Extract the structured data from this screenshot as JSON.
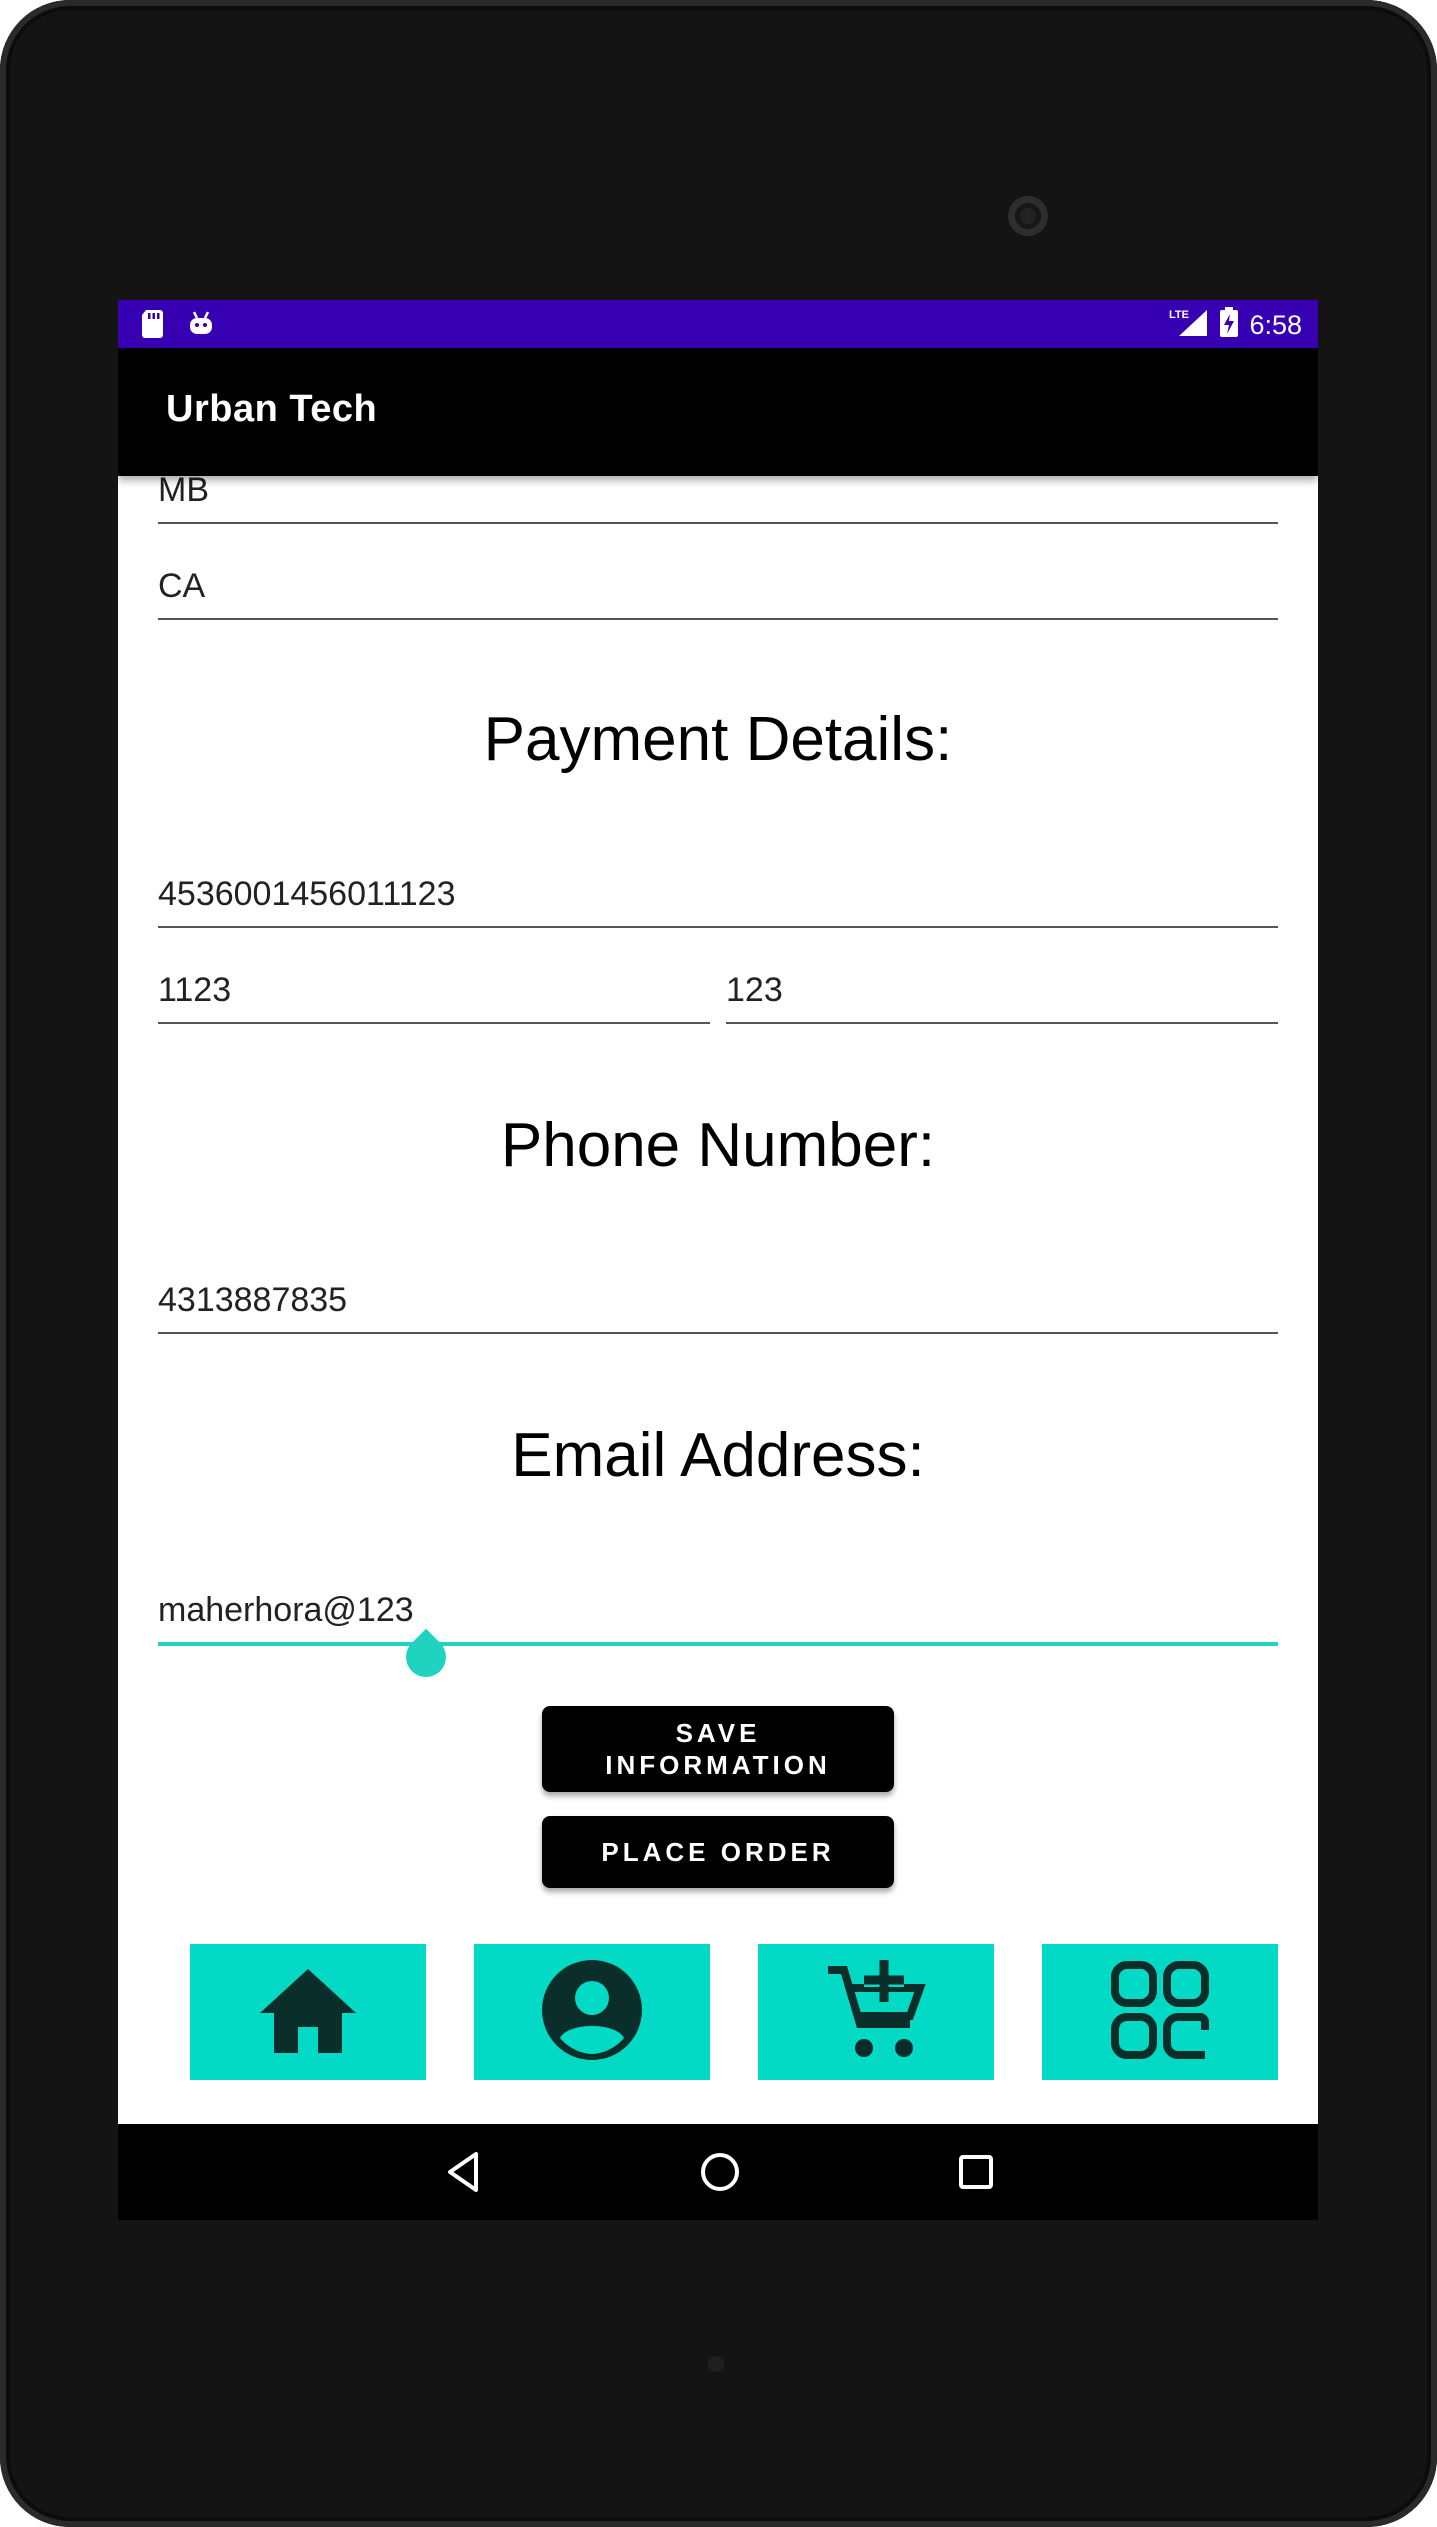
{
  "status_bar": {
    "time": "6:58",
    "network": "LTE"
  },
  "app_bar": {
    "title": "Urban Tech"
  },
  "form": {
    "province": "MB",
    "country": "CA",
    "payment_heading": "Payment Details:",
    "card_number": "4536001456011123",
    "expiry": "1123",
    "cvv": "123",
    "phone_heading": "Phone Number:",
    "phone": "4313887835",
    "email_heading": "Email Address:",
    "email": "maherhora@123"
  },
  "buttons": {
    "save_line1": "SAVE",
    "save_line2": "INFORMATION",
    "place_order": "PLACE ORDER"
  },
  "bottom_nav": {
    "items": [
      "home-icon",
      "profile-icon",
      "add-to-cart-icon",
      "apps-grid-icon"
    ],
    "color": "#03dac5"
  },
  "colors": {
    "status_bar": "#3700b3",
    "accent": "#03dac5",
    "app_bar": "#000000"
  }
}
